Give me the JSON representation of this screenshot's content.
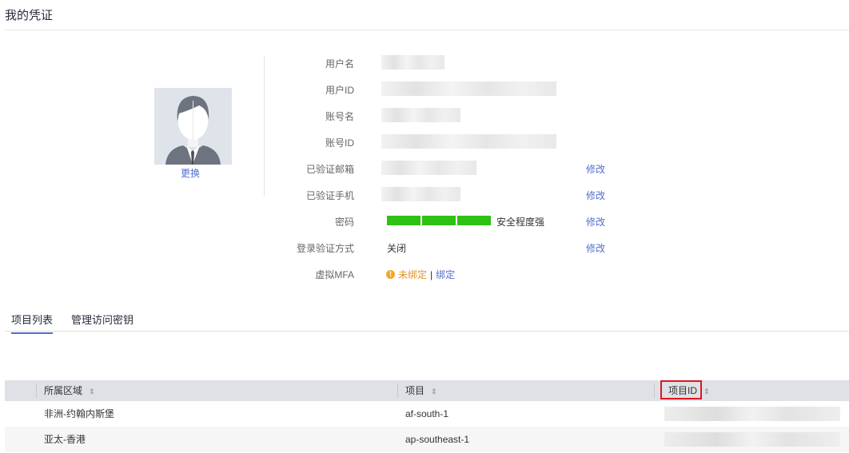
{
  "page": {
    "title": "我的凭证"
  },
  "avatar": {
    "change_label": "更换"
  },
  "fields": {
    "username_label": "用户名",
    "userid_label": "用户ID",
    "account_name_label": "账号名",
    "account_id_label": "账号ID",
    "email_label": "已验证邮箱",
    "phone_label": "已验证手机",
    "password_label": "密码",
    "login_verify_label": "登录验证方式",
    "mfa_label": "虚拟MFA"
  },
  "actions": {
    "modify": "修改"
  },
  "password": {
    "strength_text": "安全程度强",
    "strength_level": 3,
    "strength_max": 3
  },
  "login_verify": {
    "value": "关闭"
  },
  "mfa": {
    "status": "未绑定",
    "separator": "|",
    "bind_label": "绑定"
  },
  "tabs": [
    {
      "label": "项目列表",
      "active": true
    },
    {
      "label": "管理访问密钥",
      "active": false
    }
  ],
  "table": {
    "columns": [
      "所属区域",
      "项目",
      "项目ID"
    ],
    "sort_icon": "⇕",
    "rows": [
      {
        "region": "非洲-约翰内斯堡",
        "project": "af-south-1"
      },
      {
        "region": "亚太-香港",
        "project": "ap-southeast-1"
      }
    ]
  },
  "colors": {
    "accent": "#526ecc",
    "strength": "#2fc114",
    "warning": "#f5a623",
    "highlight": "#e0151f"
  }
}
